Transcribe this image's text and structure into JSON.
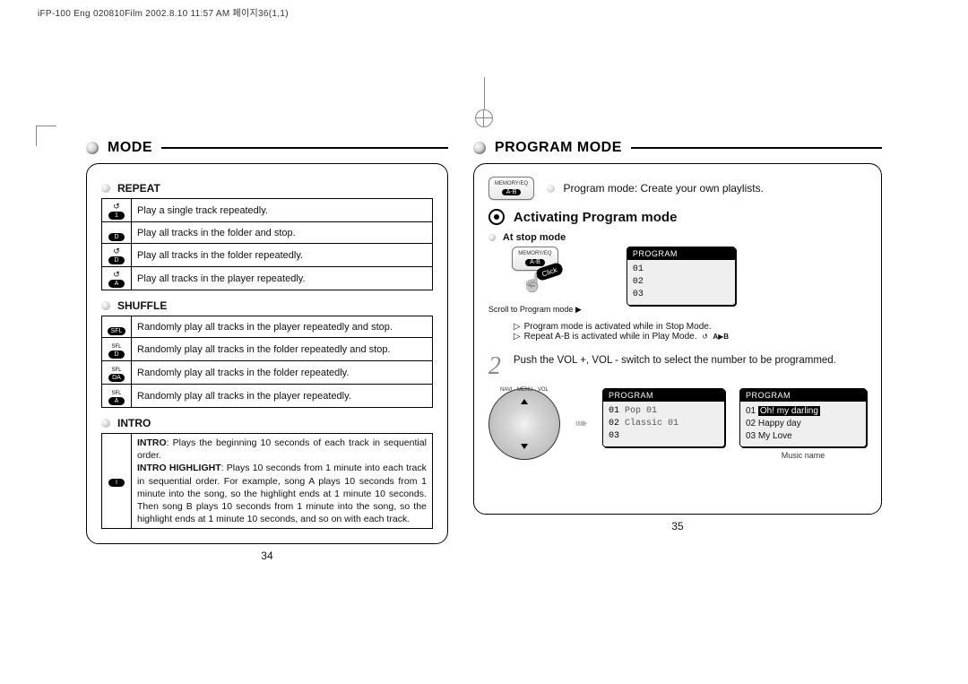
{
  "imprint": "iFP-100 Eng 020810Film  2002.8.10 11:57 AM 페이지36(1,1)",
  "left": {
    "heading": "MODE",
    "repeat": {
      "title": "REPEAT",
      "rows": [
        {
          "badge_top": "↺",
          "badge": "1",
          "text": "Play a single track repeatedly."
        },
        {
          "badge_top": "",
          "badge": "D",
          "text": "Play all tracks in the folder and stop."
        },
        {
          "badge_top": "↺",
          "badge": "D",
          "text": "Play all tracks in the folder repeatedly."
        },
        {
          "badge_top": "↺",
          "badge": "A",
          "text": "Play all tracks in the player repeatedly."
        }
      ]
    },
    "shuffle": {
      "title": "SHUFFLE",
      "rows": [
        {
          "badge_top": "",
          "badge": "SFL",
          "text": "Randomly play all tracks in the player repeatedly and stop."
        },
        {
          "badge_top": "SFL",
          "badge": "D",
          "text": "Randomly play all tracks in the folder repeatedly and stop."
        },
        {
          "badge_top": "SFL",
          "badge": "DA",
          "text": "Randomly play all tracks in the folder repeatedly."
        },
        {
          "badge_top": "SFL",
          "badge": "A",
          "text": "Randomly play all tracks in the player repeatedly."
        }
      ]
    },
    "intro": {
      "title": "INTRO",
      "badge": "I",
      "text_lead": "INTRO",
      "text_lead2": "INTRO HIGHLIGHT",
      "text1": ": Plays the beginning 10 seconds of each track in sequential order.",
      "text2": ": Plays 10 seconds from 1 minute into each track in sequential order. For example, song A plays 10 seconds from 1 minute into the song, so the highlight ends at 1 minute 10 seconds. Then song B plays 10 seconds from 1 minute into the song, so the highlight ends at 1 minute 10 seconds, and so on with each track."
    },
    "page_num": "34"
  },
  "right": {
    "heading": "PROGRAM MODE",
    "chip_top": "MEMORY/EQ",
    "chip_ab": "A-B",
    "intro_line": "Program mode: Create your own playlists.",
    "activating": "Activating Program mode",
    "at_stop": "At stop mode",
    "click": "Click",
    "scroll_line": "Scroll to Program mode",
    "lcd_small": {
      "title": "PROGRAM",
      "lines": [
        "01",
        "02",
        "03"
      ]
    },
    "note1": "Program mode is activated while in Stop Mode.",
    "note2": "Repeat A-B is activated while in Play Mode.",
    "ab_syms": {
      "a": "A",
      "b": "B"
    },
    "step2_num": "2",
    "step2_text": "Push the VOL +, VOL - switch to select the number to be programmed.",
    "wheel_label": "NAVI · MENU · VOL",
    "lcd_pop": {
      "title": "PROGRAM",
      "l1a": "01",
      "l1b": "Pop 01",
      "l2a": "02",
      "l2b": "Classic 01",
      "l3": "03"
    },
    "lcd_songs": {
      "title": "PROGRAM",
      "rows": [
        {
          "n": "01",
          "t": "Oh! my darling",
          "hl": true
        },
        {
          "n": "02",
          "t": "Happy day",
          "hl": false
        },
        {
          "n": "03",
          "t": "My Love",
          "hl": false
        }
      ],
      "caption": "Music name"
    },
    "page_num": "35"
  }
}
